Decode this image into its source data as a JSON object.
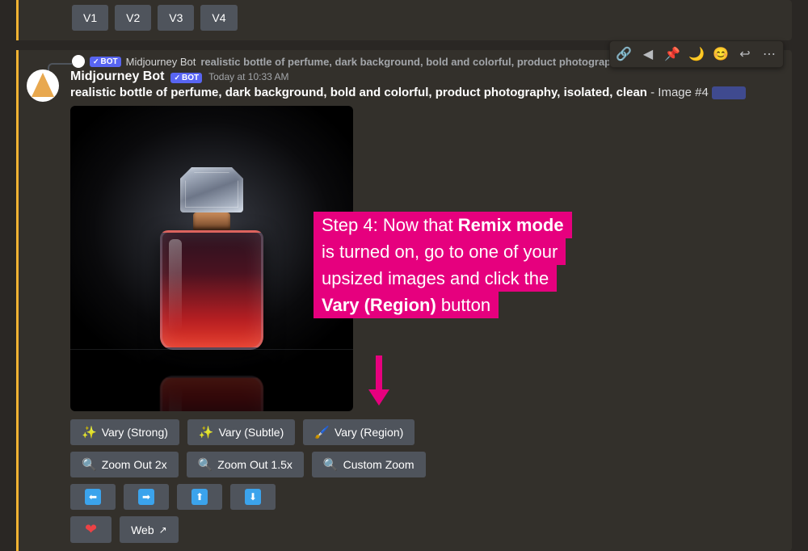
{
  "top_row": {
    "buttons": [
      "V1",
      "V2",
      "V3",
      "V4"
    ]
  },
  "reply": {
    "bot_tag": "BOT",
    "name": "Midjourney Bot",
    "text": "realistic bottle of perfume, dark background, bold and colorful, product photography, isolated, clean"
  },
  "message": {
    "author": "Midjourney Bot",
    "bot_tag": "BOT",
    "timestamp": "Today at 10:33 AM",
    "prompt": "realistic bottle of perfume, dark background, bold and colorful, product photography, isolated, clean",
    "suffix": " - Image #4 "
  },
  "actions": {
    "row1": [
      {
        "icon": "✨",
        "label": "Vary (Strong)",
        "name": "vary-strong-button"
      },
      {
        "icon": "✨",
        "label": "Vary (Subtle)",
        "name": "vary-subtle-button"
      },
      {
        "icon": "🖌️",
        "label": "Vary (Region)",
        "name": "vary-region-button"
      }
    ],
    "row2": [
      {
        "icon": "🔍",
        "label": "Zoom Out 2x",
        "name": "zoom-out-2x-button"
      },
      {
        "icon": "🔍",
        "label": "Zoom Out 1.5x",
        "name": "zoom-out-1-5x-button"
      },
      {
        "icon": "🔍",
        "label": "Custom Zoom",
        "name": "custom-zoom-button"
      }
    ],
    "row3": [
      {
        "arrow": "⬅",
        "name": "pan-left-button"
      },
      {
        "arrow": "➡",
        "name": "pan-right-button"
      },
      {
        "arrow": "⬆",
        "name": "pan-up-button"
      },
      {
        "arrow": "⬇",
        "name": "pan-down-button"
      }
    ],
    "row4": {
      "heart_name": "favorite-button",
      "web_label": "Web",
      "web_name": "web-button"
    }
  },
  "toolbar_icons": [
    {
      "glyph": "🔗",
      "name": "copy-link-icon"
    },
    {
      "glyph": "◀",
      "name": "mark-unread-icon"
    },
    {
      "glyph": "📌",
      "name": "pin-icon"
    },
    {
      "glyph": "🌙",
      "name": "moon-icon"
    },
    {
      "glyph": "😊",
      "name": "add-reaction-icon"
    },
    {
      "glyph": "↩",
      "name": "reply-icon"
    },
    {
      "glyph": "⋯",
      "name": "more-icon"
    }
  ],
  "annotation": {
    "l1a": "Step 4: Now that ",
    "l1b": "Remix mode",
    "l2": "is turned on, go to one of your",
    "l3": "upsized images and click the",
    "l4a": "Vary (Region)",
    "l4b": " button"
  }
}
